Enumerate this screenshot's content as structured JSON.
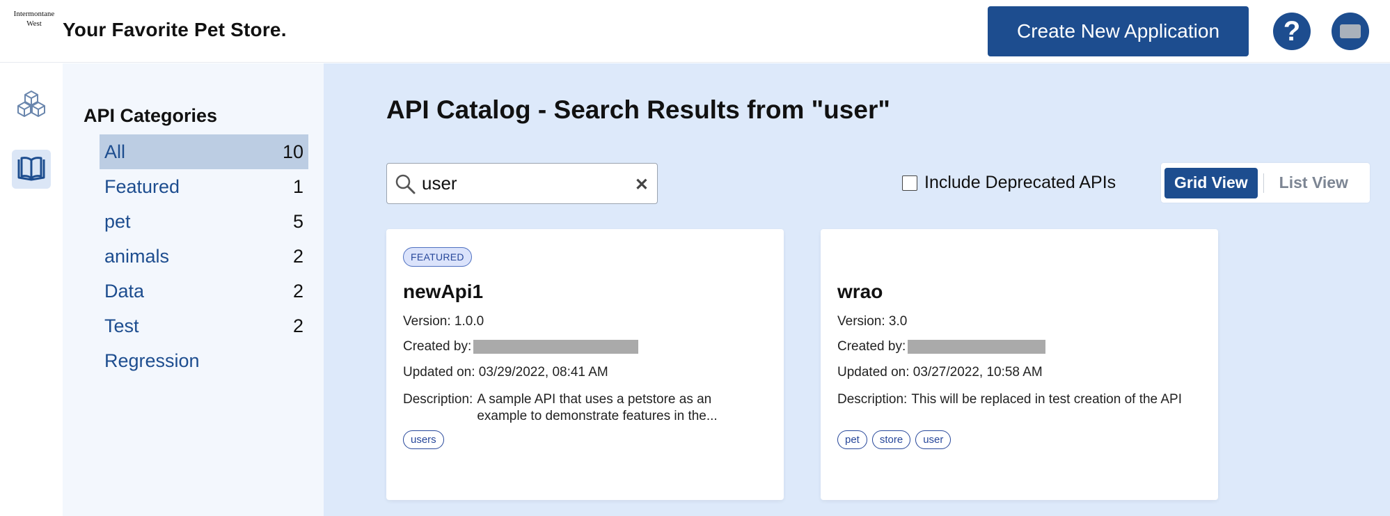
{
  "header": {
    "logo_line1": "Intermontane",
    "logo_line2": "West",
    "store_title": "Your Favorite Pet Store.",
    "create_button": "Create New Application",
    "help_label": "?"
  },
  "rail": {
    "items": [
      {
        "icon": "cubes-icon",
        "active": false
      },
      {
        "icon": "open-book-icon",
        "active": true
      }
    ]
  },
  "categories": {
    "title": "API Categories",
    "items": [
      {
        "label": "All",
        "count": "10",
        "selected": true
      },
      {
        "label": "Featured",
        "count": "1"
      },
      {
        "label": "pet",
        "count": "5"
      },
      {
        "label": "animals",
        "count": "2"
      },
      {
        "label": "Data",
        "count": "2"
      },
      {
        "label": "Test",
        "count": "2"
      },
      {
        "label": "Regression",
        "count": ""
      }
    ]
  },
  "main": {
    "title": "API Catalog - Search Results from \"user\"",
    "search_value": "user",
    "clear_icon": "close-icon",
    "deprecated_label": "Include Deprecated APIs",
    "deprecated_checked": false,
    "grid_view": "Grid View",
    "list_view": "List View",
    "cards": [
      {
        "badge": "FEATURED",
        "title": "newApi1",
        "version": "Version: 1.0.0",
        "created_by_label": "Created by:",
        "updated_on": "Updated on: 03/29/2022, 08:41 AM",
        "description_label": "Description:",
        "description": "A sample API that uses a petstore as an example to demonstrate features in the...",
        "tags": [
          "users"
        ]
      },
      {
        "badge": "",
        "title": "wrao",
        "version": "Version: 3.0",
        "created_by_label": "Created by:",
        "updated_on": "Updated on: 03/27/2022, 10:58 AM",
        "description_label": "Description:",
        "description": "This will be replaced in test creation of the API",
        "tags": [
          "pet",
          "store",
          "user"
        ]
      }
    ]
  },
  "colors": {
    "brand": "#1d4d8f",
    "sidebar_bg": "#f3f7fd",
    "main_bg": "#dde9fa",
    "selected_bg": "#bccde3"
  }
}
